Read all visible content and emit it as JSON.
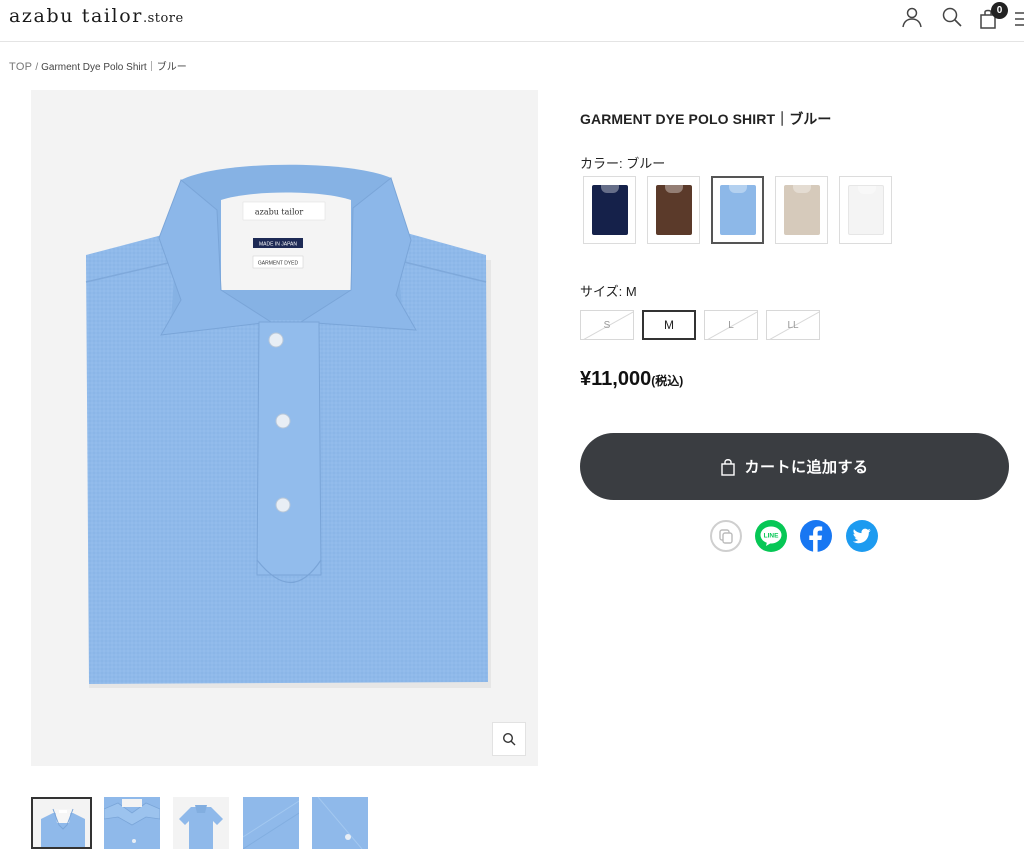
{
  "header": {
    "logo_main": "azabu tailor",
    "logo_suffix": ".store",
    "cart_count": "0",
    "icons": [
      "user-icon",
      "search-icon",
      "bag-icon",
      "menu-icon"
    ]
  },
  "breadcrumb": {
    "home": "TOP",
    "separator": "/",
    "current": "Garment Dye Polo Shirt｜ブルー"
  },
  "product": {
    "title": "GARMENT DYE POLO SHIRT｜ブルー",
    "color_label": "カラー: ブルー",
    "colors": [
      {
        "name": "navy",
        "hex": "#15214a",
        "selected": false
      },
      {
        "name": "brown",
        "hex": "#5b3a2a",
        "selected": false
      },
      {
        "name": "blue",
        "hex": "#8db8e8",
        "selected": true
      },
      {
        "name": "beige",
        "hex": "#d6cabb",
        "selected": false
      },
      {
        "name": "white",
        "hex": "#f4f4f4",
        "selected": false
      }
    ],
    "size_label": "サイズ:  M",
    "sizes": [
      {
        "label": "S",
        "available": false,
        "selected": false
      },
      {
        "label": "M",
        "available": true,
        "selected": true
      },
      {
        "label": "L",
        "available": false,
        "selected": false
      },
      {
        "label": "LL",
        "available": false,
        "selected": false
      }
    ],
    "price": "¥11,000",
    "tax_note": "(税込)",
    "add_to_cart": "カートに追加する",
    "shirt_color": "#8fb9ea",
    "label_brand": "azabu tailor",
    "label_made_in": "MADE IN JAPAN",
    "label_garment": "GARMENT DYED"
  },
  "share": {
    "line_text": "LINE"
  },
  "colors": {
    "button_dark": "#3a3d41",
    "line_green": "#06c755",
    "facebook_blue": "#1877f2",
    "twitter_blue": "#1d9bf0"
  }
}
